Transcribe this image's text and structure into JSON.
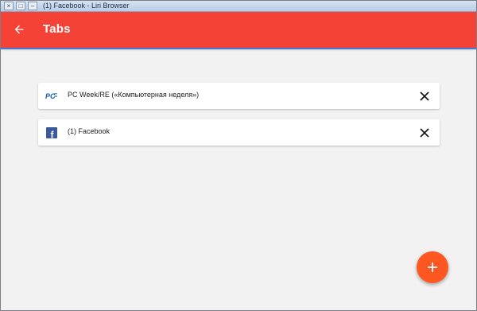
{
  "window": {
    "title": "(1) Facebook - Liri Browser",
    "controls": [
      "×",
      "□",
      "–"
    ]
  },
  "appbar": {
    "title": "Tabs",
    "back_icon": "arrow-left-icon",
    "color": "#f44336"
  },
  "tabs": [
    {
      "title": "PC Week/RE («Компьютерная неделя»)",
      "favicon": "pcweek-favicon-icon",
      "favicon_text": "PC"
    },
    {
      "title": "(1) Facebook",
      "favicon": "facebook-favicon-icon",
      "favicon_text": "f"
    }
  ],
  "fab": {
    "label": "+",
    "icon": "plus-icon",
    "color": "#ff5722"
  }
}
